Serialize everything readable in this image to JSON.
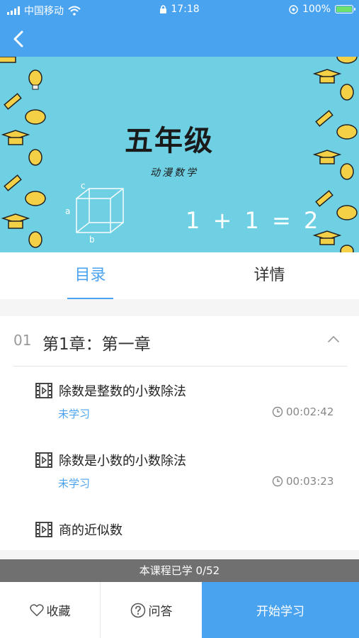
{
  "status_bar": {
    "carrier": "中国移动",
    "time": "17:18",
    "battery": "100%",
    "icons": [
      "signal-icon",
      "wifi-icon",
      "lock-icon",
      "location-icon",
      "battery-icon"
    ]
  },
  "nav": {
    "back_icon": "back-arrow-icon"
  },
  "banner": {
    "title": "五年级",
    "subtitle": "动漫数学",
    "formula": "1 + 1 = 2",
    "cube_labels": [
      "a",
      "c",
      "b"
    ],
    "background_color": "#6fd0e3"
  },
  "tabs": [
    {
      "label": "目录",
      "active": true
    },
    {
      "label": "详情",
      "active": false
    }
  ],
  "chapter": {
    "number": "01",
    "title": "第1章：第一章",
    "expanded": true,
    "lessons": [
      {
        "title": "除数是整数的小数除法",
        "status": "未学习",
        "duration": "00:02:42"
      },
      {
        "title": " 除数是小数的小数除法",
        "status": "未学习",
        "duration": "00:03:23"
      },
      {
        "title": "商的近似数",
        "status": "",
        "duration": ""
      }
    ]
  },
  "progress": {
    "label": "本课程已学 0/52"
  },
  "bottom_bar": {
    "favorite_label": "收藏",
    "qa_label": "问答",
    "start_label": "开始学习"
  },
  "colors": {
    "accent": "#4aa3ef",
    "progress_bg": "#707070",
    "battery_fill": "#6ee06e"
  }
}
